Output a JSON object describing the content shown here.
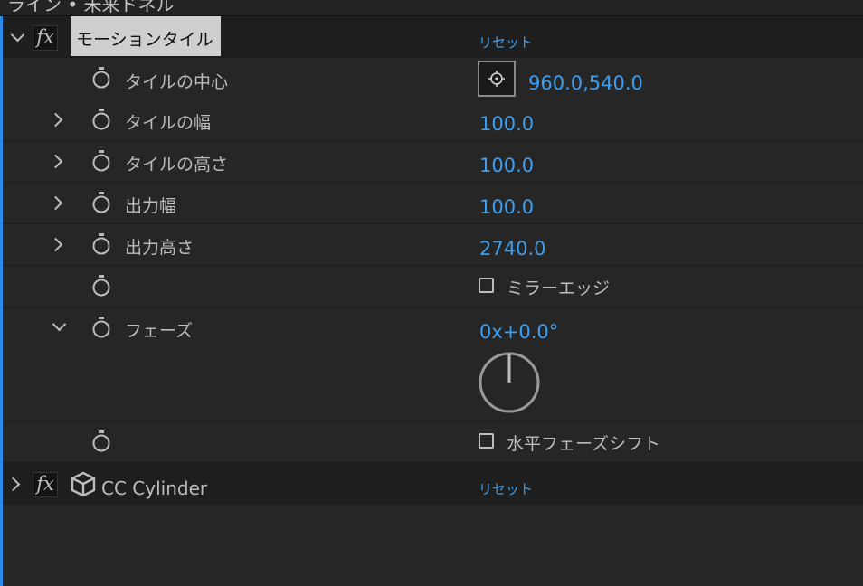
{
  "panel": {
    "title_fragment": "ライン • 未来ドネル"
  },
  "effects": [
    {
      "name": "モーションタイル",
      "reset_label": "リセット",
      "expanded": true,
      "params": [
        {
          "label": "タイルの中心",
          "value": "960.0,540.0",
          "icon": "crosshair-target-icon"
        },
        {
          "label": "タイルの幅",
          "value": "100.0"
        },
        {
          "label": "タイルの高さ",
          "value": "100.0"
        },
        {
          "label": "出力幅",
          "value": "100.0"
        },
        {
          "label": "出力高さ",
          "value": "2740.0"
        },
        {
          "label": "",
          "checkbox_label": "ミラーエッジ",
          "checked": false
        },
        {
          "label": "フェーズ",
          "value": "0x+0.0°",
          "dial_angle_deg": 0
        },
        {
          "label": "",
          "checkbox_label": "水平フェーズシフト",
          "checked": false
        }
      ]
    },
    {
      "name": "CC Cylinder",
      "reset_label": "リセット",
      "expanded": false,
      "icon": "3d-cube-icon"
    }
  ],
  "colors": {
    "accent": "#3c9ef0",
    "panel_bg": "#232323",
    "selection_bg": "#cfcfcf",
    "left_accent": "#2d8ceb"
  }
}
